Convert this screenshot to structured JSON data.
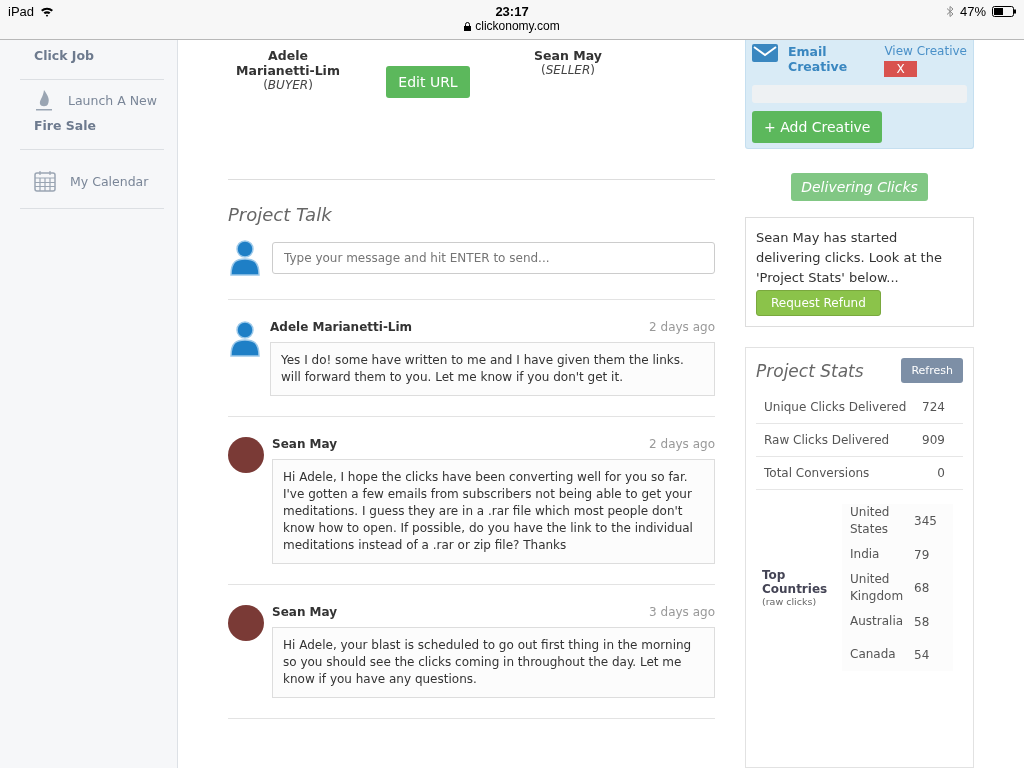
{
  "status_bar": {
    "device": "iPad",
    "time": "23:17",
    "url": "clickonomy.com",
    "battery": "47%"
  },
  "sidebar": {
    "items": [
      {
        "line2": "Click Job"
      },
      {
        "kind": "flame",
        "line1": "Launch A New",
        "line2": "Fire Sale"
      },
      {
        "kind": "calendar",
        "line1": "My Calendar"
      }
    ]
  },
  "parties": [
    {
      "name": "Adele Marianetti-Lim",
      "role": "(*BUYER*)"
    },
    {
      "name": "Sean May",
      "role": "(*SELLER*)"
    }
  ],
  "edit_url_button": "Edit URL",
  "project_talk": {
    "title": "Project Talk",
    "composer_placeholder": "Type your message and hit ENTER to send...",
    "messages": [
      {
        "author": "Adele Marianetti-Lim",
        "kind": "silhouette",
        "time": "2 days ago",
        "text": "Yes I do! some have written to me and I have given them the links. will forward them to you. Let me know if you don't get it."
      },
      {
        "author": "Sean May",
        "kind": "photo",
        "time": "2 days ago",
        "text": "Hi Adele, I hope the clicks have been converting well for you so far. I've gotten a few emails from subscribers not being able to get your meditations. I guess they are in a .rar file which most people don't know how to open. If possible, do you have the link to the individual meditations instead of a .rar or zip file? Thanks"
      },
      {
        "author": "Sean May",
        "kind": "photo",
        "time": "3 days ago",
        "text": "Hi Adele, your blast is scheduled to go out first thing in the morning so you should see the clicks coming in throughout the day. Let me know if you have any questions."
      }
    ]
  },
  "creative": {
    "name": "Email Creative",
    "view_link": "View Creative",
    "remove_button": "X",
    "add_button": "+ Add Creative"
  },
  "status_badge": "Delivering Clicks",
  "notice": {
    "text": "Sean May has started delivering clicks. Look at the 'Project Stats' below...",
    "button": "Request Refund"
  },
  "project_stats": {
    "title": "Project Stats",
    "refresh_button": "Refresh",
    "rows": [
      {
        "label": "Unique Clicks Delivered",
        "value": "724"
      },
      {
        "label": "Raw Clicks Delivered",
        "value": "909"
      },
      {
        "label": "Total Conversions",
        "value": "0"
      }
    ],
    "top_countries": {
      "title": "Top Countries",
      "note": "(raw clicks)",
      "countries": [
        {
          "name": "United States",
          "value": "345"
        },
        {
          "name": "India",
          "value": "79"
        },
        {
          "name": "United Kingdom",
          "value": "68"
        },
        {
          "name": "Australia",
          "value": "58"
        },
        {
          "name": "Canada",
          "value": "54"
        }
      ]
    }
  }
}
